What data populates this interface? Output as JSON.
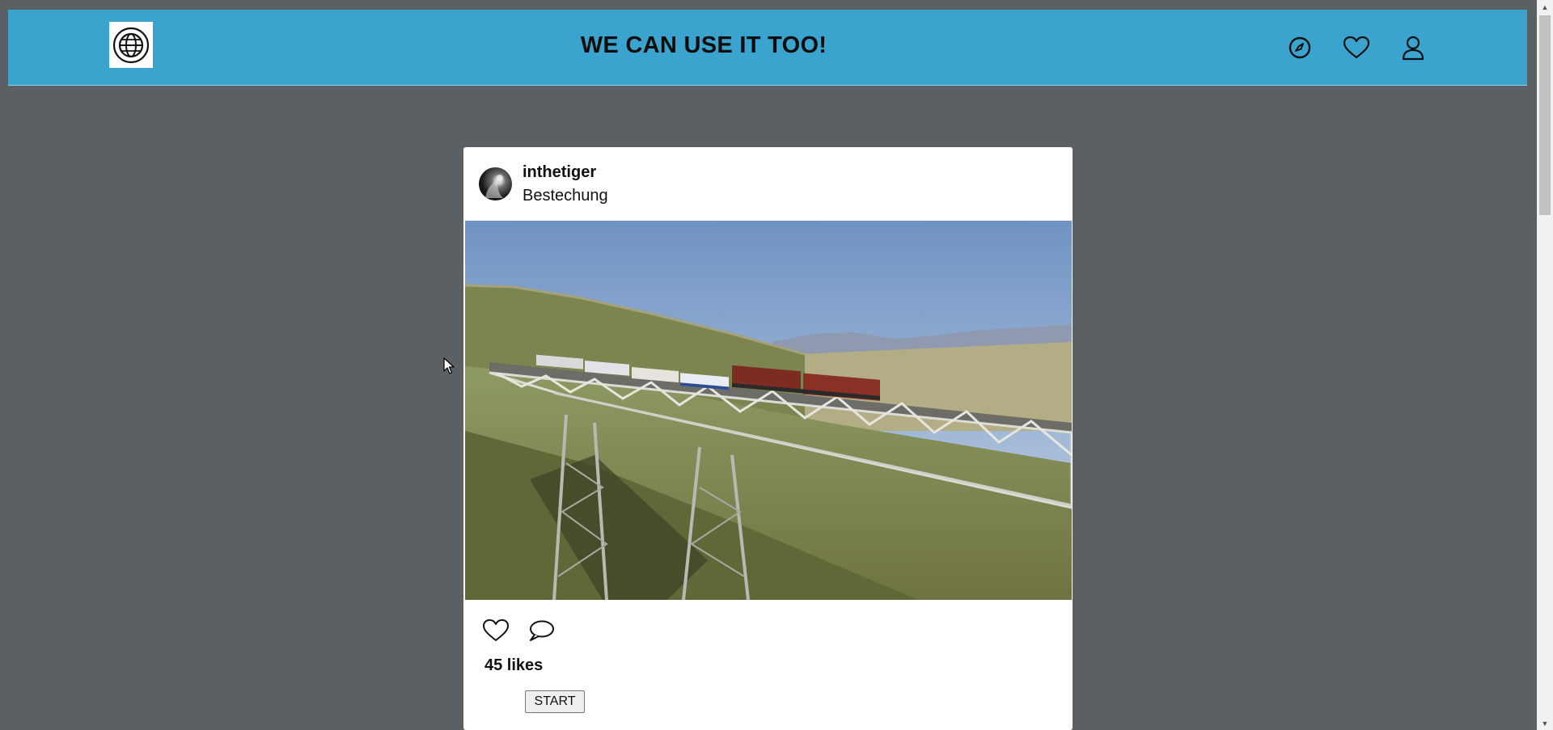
{
  "header": {
    "title": "WE CAN USE IT TOO!",
    "background_color": "#3aa4cf",
    "logo_icon": "globe-icon",
    "nav_icons": [
      "compass-icon",
      "heart-icon",
      "user-icon"
    ]
  },
  "post": {
    "username": "inthetiger",
    "caption": "Bestechung",
    "image_subject": "train-on-bridge-photo",
    "likes_text": "45 likes",
    "action_icons": [
      "like-heart-icon",
      "comment-icon"
    ],
    "start_button_label": "START"
  },
  "page": {
    "background_color": "#5b6065"
  }
}
